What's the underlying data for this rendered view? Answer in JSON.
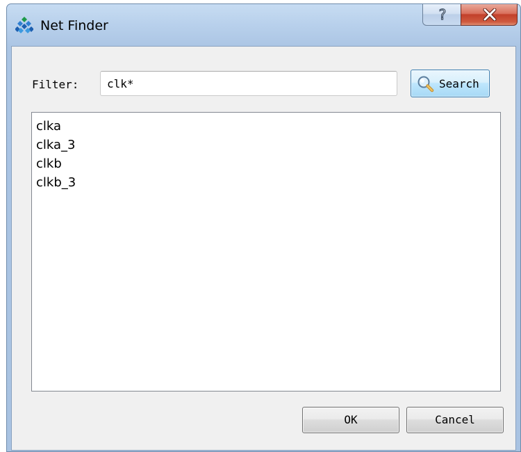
{
  "window": {
    "title": "Net Finder",
    "help_glyph": "?",
    "close_glyph": "x"
  },
  "filter": {
    "label": "Filter:",
    "value": "clk*"
  },
  "search_button": {
    "label": "Search",
    "icon": "search-icon"
  },
  "nets": [
    {
      "name": "clka"
    },
    {
      "name": "clka_3"
    },
    {
      "name": "clkb"
    },
    {
      "name": "clkb_3"
    }
  ],
  "buttons": {
    "ok": "OK",
    "cancel": "Cancel"
  },
  "colors": {
    "frame": "#b9d1ec",
    "client_bg": "#f0f0f0",
    "close_button": "#c2402a",
    "search_button": "#bee6fd"
  }
}
